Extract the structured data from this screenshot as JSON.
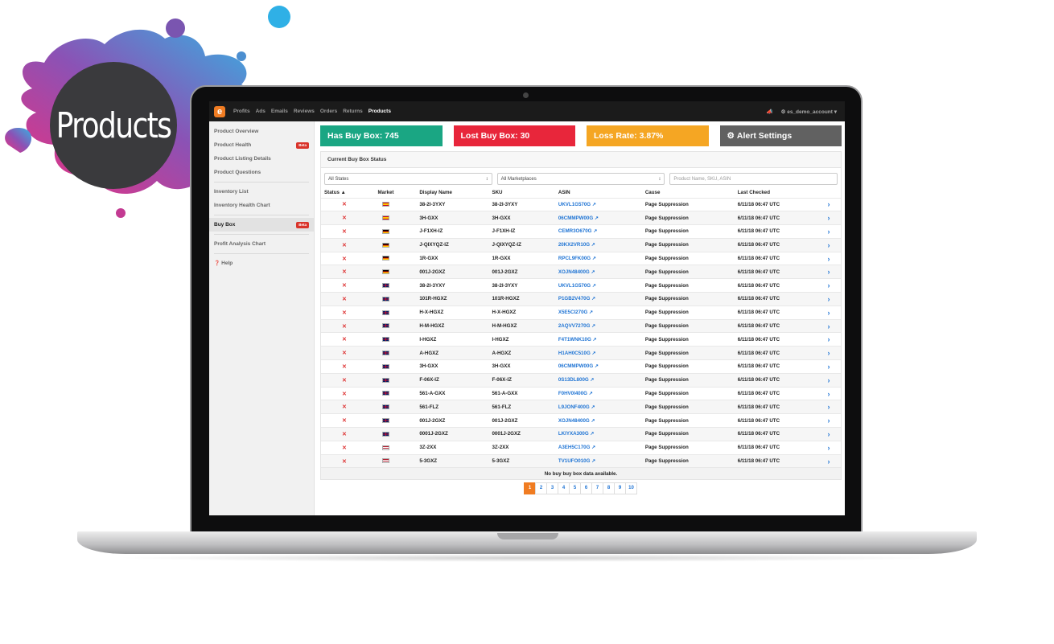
{
  "badge": {
    "title": "Products"
  },
  "topbar": {
    "logo": "e",
    "nav": [
      "Profits",
      "Ads",
      "Emails",
      "Reviews",
      "Orders",
      "Returns",
      "Products"
    ],
    "active_nav": "Products",
    "account": "es_demo_account"
  },
  "sidebar": {
    "groups": [
      [
        {
          "label": "Product Overview"
        },
        {
          "label": "Product Health",
          "badge": "Beta"
        },
        {
          "label": "Product Listing Details"
        },
        {
          "label": "Product Questions"
        }
      ],
      [
        {
          "label": "Inventory List"
        },
        {
          "label": "Inventory Health Chart"
        }
      ],
      [
        {
          "label": "Buy Box",
          "badge": "Beta",
          "active": true
        }
      ],
      [
        {
          "label": "Profit Analysis Chart"
        }
      ],
      [
        {
          "label": "Help",
          "icon": "question-circle-icon"
        }
      ]
    ]
  },
  "stats": {
    "has_buy_box": "Has Buy Box: 745",
    "lost_buy_box": "Lost Buy Box: 30",
    "loss_rate": "Loss Rate: 3.87%",
    "alert_settings": "Alert Settings"
  },
  "panel": {
    "title": "Current Buy Box Status",
    "filter_states": "All States",
    "filter_marketplaces": "All Marketplaces",
    "search_placeholder": "Product Name, SKU, ASIN",
    "columns": [
      "Status ▲",
      "Market",
      "Display Name",
      "SKU",
      "ASIN",
      "Cause",
      "Last Checked"
    ],
    "rows": [
      {
        "market": "es",
        "name": "38-2I-3YXY",
        "sku": "38-2I-3YXY",
        "asin": "UKVL1G570G",
        "cause": "Page Suppression",
        "checked": "6/11/18 06:47 UTC"
      },
      {
        "market": "es",
        "name": "3H-GXX",
        "sku": "3H-GXX",
        "asin": "06CMMPW00G",
        "cause": "Page Suppression",
        "checked": "6/11/18 06:47 UTC"
      },
      {
        "market": "de",
        "name": "J-F1XH-IZ",
        "sku": "J-F1XH-IZ",
        "asin": "CEMR3O670G",
        "cause": "Page Suppression",
        "checked": "6/11/18 06:47 UTC"
      },
      {
        "market": "de",
        "name": "J-QIXYQZ-IZ",
        "sku": "J-QIXYQZ-IZ",
        "asin": "20KX2VR10G",
        "cause": "Page Suppression",
        "checked": "6/11/18 06:47 UTC"
      },
      {
        "market": "de",
        "name": "1R-GXX",
        "sku": "1R-GXX",
        "asin": "RPCL9FK00G",
        "cause": "Page Suppression",
        "checked": "6/11/18 06:47 UTC"
      },
      {
        "market": "de",
        "name": "001J-2GXZ",
        "sku": "001J-2GXZ",
        "asin": "XOJN48400G",
        "cause": "Page Suppression",
        "checked": "6/11/18 06:47 UTC"
      },
      {
        "market": "uk",
        "name": "38-2I-3YXY",
        "sku": "38-2I-3YXY",
        "asin": "UKVL1G570G",
        "cause": "Page Suppression",
        "checked": "6/11/18 06:47 UTC"
      },
      {
        "market": "uk",
        "name": "101R-HGXZ",
        "sku": "101R-HGXZ",
        "asin": "P1GB2V470G",
        "cause": "Page Suppression",
        "checked": "6/11/18 06:47 UTC"
      },
      {
        "market": "uk",
        "name": "H-X-HGXZ",
        "sku": "H-X-HGXZ",
        "asin": "X5E5CI270G",
        "cause": "Page Suppression",
        "checked": "6/11/18 06:47 UTC"
      },
      {
        "market": "uk",
        "name": "H-M-HGXZ",
        "sku": "H-M-HGXZ",
        "asin": "2AQVV7270G",
        "cause": "Page Suppression",
        "checked": "6/11/18 06:47 UTC"
      },
      {
        "market": "uk",
        "name": "I-HGXZ",
        "sku": "I-HGXZ",
        "asin": "F4T1WNK10G",
        "cause": "Page Suppression",
        "checked": "6/11/18 06:47 UTC"
      },
      {
        "market": "uk",
        "name": "A-HGXZ",
        "sku": "A-HGXZ",
        "asin": "H1AH0C510G",
        "cause": "Page Suppression",
        "checked": "6/11/18 06:47 UTC"
      },
      {
        "market": "uk",
        "name": "3H-GXX",
        "sku": "3H-GXX",
        "asin": "06CMMPW00G",
        "cause": "Page Suppression",
        "checked": "6/11/18 06:47 UTC"
      },
      {
        "market": "uk",
        "name": "F-06X-IZ",
        "sku": "F-06X-IZ",
        "asin": "0S13DL800G",
        "cause": "Page Suppression",
        "checked": "6/11/18 06:47 UTC"
      },
      {
        "market": "uk",
        "name": "561-A-GXX",
        "sku": "561-A-GXX",
        "asin": "F0HV0I400G",
        "cause": "Page Suppression",
        "checked": "6/11/18 06:47 UTC"
      },
      {
        "market": "uk",
        "name": "561-FLZ",
        "sku": "561-FLZ",
        "asin": "L9JONF400G",
        "cause": "Page Suppression",
        "checked": "6/11/18 06:47 UTC"
      },
      {
        "market": "uk",
        "name": "001J-2GXZ",
        "sku": "001J-2GXZ",
        "asin": "XOJN48400G",
        "cause": "Page Suppression",
        "checked": "6/11/18 06:47 UTC"
      },
      {
        "market": "uk",
        "name": "0001J-2GXZ",
        "sku": "0001J-2GXZ",
        "asin": "LKIYXA300G",
        "cause": "Page Suppression",
        "checked": "6/11/18 06:47 UTC"
      },
      {
        "market": "us",
        "name": "3Z-2XX",
        "sku": "3Z-2XX",
        "asin": "A3EH5C170G",
        "cause": "Page Suppression",
        "checked": "6/11/18 06:47 UTC"
      },
      {
        "market": "us",
        "name": "5-3GXZ",
        "sku": "5-3GXZ",
        "asin": "TV1UFO010G",
        "cause": "Page Suppression",
        "checked": "6/11/18 06:47 UTC"
      }
    ],
    "empty_note": "No buy buy box data available."
  },
  "pagination": {
    "pages": [
      "1",
      "2",
      "3",
      "4",
      "5",
      "6",
      "7",
      "8",
      "9",
      "10"
    ],
    "current": "1"
  },
  "colors": {
    "accent": "#f07c22",
    "green": "#1aa683",
    "red": "#e8263b",
    "orange": "#f5a623",
    "grey": "#616161",
    "link": "#1f74d4",
    "splash": [
      "#e83e8c",
      "#8a4fb3",
      "#3fa9de"
    ]
  }
}
